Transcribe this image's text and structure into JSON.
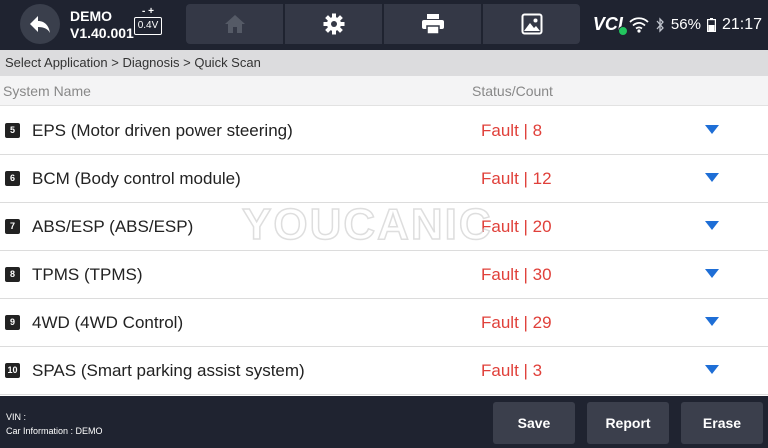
{
  "topbar": {
    "vehicle_name": "DEMO",
    "version": "V1.40.001",
    "battery_terminals": "- +",
    "battery_voltage": "0.4V",
    "toolbar": [
      {
        "icon": "home-icon"
      },
      {
        "icon": "gear-icon"
      },
      {
        "icon": "printer-icon"
      },
      {
        "icon": "image-icon"
      }
    ],
    "vci_label": "VCI",
    "battery_percent": "56%",
    "time": "21:17"
  },
  "breadcrumb": "Select Application > Diagnosis > Quick Scan",
  "table": {
    "columns": [
      "System Name",
      "Status/Count"
    ],
    "rows": [
      {
        "index": "5",
        "name": "EPS (Motor driven power steering)",
        "status": "Fault | 8"
      },
      {
        "index": "6",
        "name": "BCM (Body control module)",
        "status": "Fault | 12"
      },
      {
        "index": "7",
        "name": "ABS/ESP (ABS/ESP)",
        "status": "Fault | 20"
      },
      {
        "index": "8",
        "name": "TPMS (TPMS)",
        "status": "Fault | 30"
      },
      {
        "index": "9",
        "name": "4WD (4WD Control)",
        "status": "Fault | 29"
      },
      {
        "index": "10",
        "name": "SPAS (Smart parking assist system)",
        "status": "Fault | 3"
      }
    ]
  },
  "watermark": "YOUCANIC",
  "footer": {
    "vin_label": "VIN :",
    "car_info": "Car Information : DEMO",
    "buttons": {
      "save": "Save",
      "report": "Report",
      "erase": "Erase"
    }
  },
  "colors": {
    "fault": "#e0403a",
    "caret": "#1e6ed6",
    "bar": "#1f2330",
    "vci_connected": "#22c55e"
  }
}
